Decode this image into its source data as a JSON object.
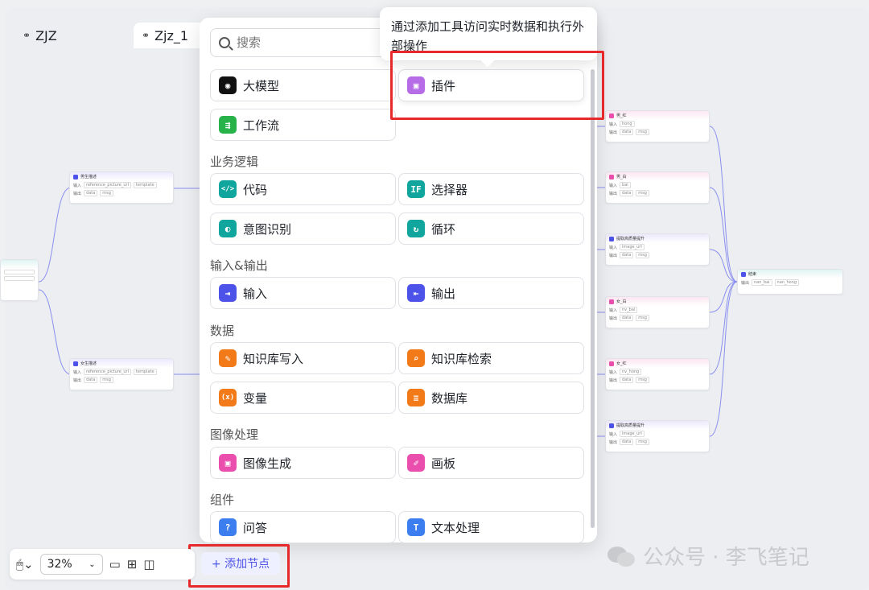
{
  "tabs": [
    {
      "label": "ZJZ"
    },
    {
      "label": "Zjz_1"
    }
  ],
  "search": {
    "placeholder": "搜索"
  },
  "tooltip": {
    "text": "通过添加工具访问实时数据和执行外部操作"
  },
  "panel": {
    "top_items": [
      {
        "label": "大模型",
        "icon": "llm-icon",
        "color": "#111111"
      },
      {
        "label": "插件",
        "icon": "plugin-cube-icon",
        "color": "#b66ce6"
      },
      {
        "label": "工作流",
        "icon": "workflow-icon",
        "color": "#27b24a"
      }
    ],
    "sections": [
      {
        "title": "业务逻辑",
        "items": [
          {
            "label": "代码",
            "icon": "code-icon",
            "color": "#11a69d",
            "glyph": "</>"
          },
          {
            "label": "选择器",
            "icon": "selector-icon",
            "color": "#11a69d",
            "glyph": "IF"
          },
          {
            "label": "意图识别",
            "icon": "intent-icon",
            "color": "#11a69d",
            "glyph": "◐"
          },
          {
            "label": "循环",
            "icon": "loop-icon",
            "color": "#11a69d",
            "glyph": "↻"
          }
        ]
      },
      {
        "title": "输入&输出",
        "items": [
          {
            "label": "输入",
            "icon": "input-icon",
            "color": "#4d53e8",
            "glyph": "⇥"
          },
          {
            "label": "输出",
            "icon": "output-icon",
            "color": "#4d53e8",
            "glyph": "⇤"
          }
        ]
      },
      {
        "title": "数据",
        "items": [
          {
            "label": "知识库写入",
            "icon": "knowledge-write-icon",
            "color": "#f27a19",
            "glyph": "✎"
          },
          {
            "label": "知识库检索",
            "icon": "knowledge-search-icon",
            "color": "#f27a19",
            "glyph": "⌕"
          },
          {
            "label": "变量",
            "icon": "variable-icon",
            "color": "#f27a19",
            "glyph": "(x)"
          },
          {
            "label": "数据库",
            "icon": "database-icon",
            "color": "#f27a19",
            "glyph": "≡"
          }
        ]
      },
      {
        "title": "图像处理",
        "items": [
          {
            "label": "图像生成",
            "icon": "image-gen-icon",
            "color": "#ea4fae",
            "glyph": "▣"
          },
          {
            "label": "画板",
            "icon": "canvas-icon",
            "color": "#ea4fae",
            "glyph": "✐"
          }
        ]
      },
      {
        "title": "组件",
        "items": [
          {
            "label": "问答",
            "icon": "qa-icon",
            "color": "#3c7ef0",
            "glyph": "?"
          },
          {
            "label": "文本处理",
            "icon": "text-process-icon",
            "color": "#3c7ef0",
            "glyph": "T"
          }
        ]
      }
    ]
  },
  "toolbar": {
    "zoom": "32%",
    "add_node": "+ 添加节点"
  },
  "watermark": {
    "text": "公众号 · 李飞笔记"
  },
  "canvas_nodes": {
    "male_desc": "男生描述",
    "female_desc": "女生描述",
    "n1": "男_红",
    "n2": "男_白",
    "n3": "提取高质量提升",
    "n4": "女_白",
    "n5": "女_红",
    "n6": "提取高质量提升",
    "end": "结束",
    "input_lbl": "输入",
    "output_lbl": "输出",
    "chip_ref": "reference_picture_url",
    "chip_tmpl": "template",
    "chip_data": "data",
    "chip_msg": "msg",
    "chip_hong": "hong",
    "chip_bai": "bai",
    "chip_img": "image_url",
    "chip_nvbai": "nv_bai",
    "chip_nvhong": "nv_hong",
    "chip_nanbai": "nan_bai",
    "chip_nanhong": "nan_hong"
  }
}
